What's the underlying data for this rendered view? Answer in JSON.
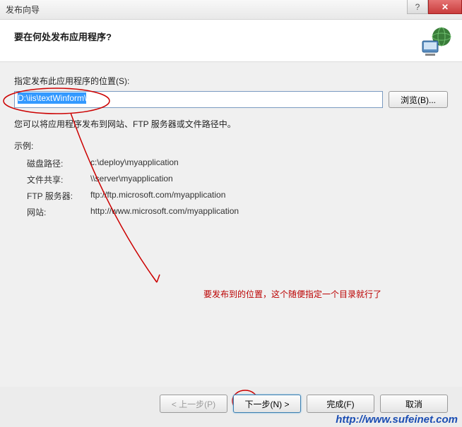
{
  "titlebar": {
    "title": "发布向导",
    "close_glyph": "✕"
  },
  "header": {
    "title": "要在何处发布应用程序?"
  },
  "content": {
    "location_label": "指定发布此应用程序的位置(S):",
    "location_value": "D:\\iis\\textWinform\\",
    "browse_label": "浏览(B)...",
    "hint": "您可以将应用程序发布到网站、FTP 服务器或文件路径中。",
    "example_label": "示例:",
    "examples": [
      {
        "key": "磁盘路径:",
        "val": "c:\\deploy\\myapplication"
      },
      {
        "key": "文件共享:",
        "val": "\\\\server\\myapplication"
      },
      {
        "key": "FTP 服务器:",
        "val": "ftp://ftp.microsoft.com/myapplication"
      },
      {
        "key": "网站:",
        "val": "http://www.microsoft.com/myapplication"
      }
    ]
  },
  "annotation": {
    "text": "要发布到的位置，这个随便指定一个目录就行了"
  },
  "footer": {
    "back": "< 上一步(P)",
    "next": "下一步(N) >",
    "finish": "完成(F)",
    "cancel": "取消"
  },
  "watermark": "http://www.sufeinet.com"
}
